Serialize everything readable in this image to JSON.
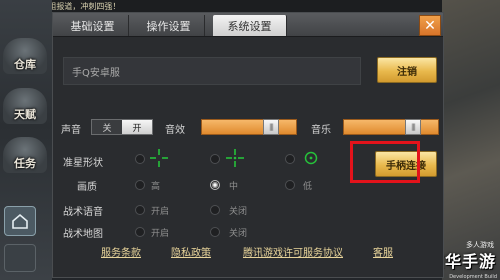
{
  "background": {
    "chat_text": "[世界] 考核C组报道，冲刺四强！",
    "side_buttons": [
      "仓库",
      "天赋",
      "任务"
    ],
    "right_caption": "多人游戏",
    "watermark": "京华手游",
    "watermark_sub": "Development Build"
  },
  "tabs": [
    {
      "label": "基础设置",
      "active": false
    },
    {
      "label": "操作设置",
      "active": false
    },
    {
      "label": "系统设置",
      "active": true
    }
  ],
  "close_label": "✕",
  "account": {
    "server_text": "手Q安卓服",
    "logout_label": "注销"
  },
  "audio": {
    "sound_label": "声音",
    "sound_off": "关",
    "sound_on": "开",
    "sound_value": "开",
    "effects_label": "音效",
    "effects_level": 0.78,
    "music_label": "音乐",
    "music_level": 0.78,
    "knob_glyph": "|||"
  },
  "crosshair": {
    "label": "准星形状",
    "options": [
      "cross-gap",
      "cross-dot",
      "circle-dot"
    ],
    "selected_index": null,
    "color": "#26c13a"
  },
  "controller_button": "手柄连接",
  "quality": {
    "label": "画质",
    "options": [
      "高",
      "中",
      "低"
    ],
    "selected": "中"
  },
  "voice": {
    "label": "战术语音",
    "options": [
      "开启",
      "关闭"
    ],
    "selected": null
  },
  "tactical_map": {
    "label": "战术地图",
    "options": [
      "开启",
      "关闭"
    ],
    "selected": null
  },
  "footer_links": [
    "服务条款",
    "隐私政策",
    "腾讯游戏许可服务协议",
    "客服"
  ],
  "colors": {
    "accent_orange": "#e08a2e",
    "gold_button": "#e9b94d",
    "highlight_red": "#e3131b",
    "link_color": "#e8d49a"
  }
}
